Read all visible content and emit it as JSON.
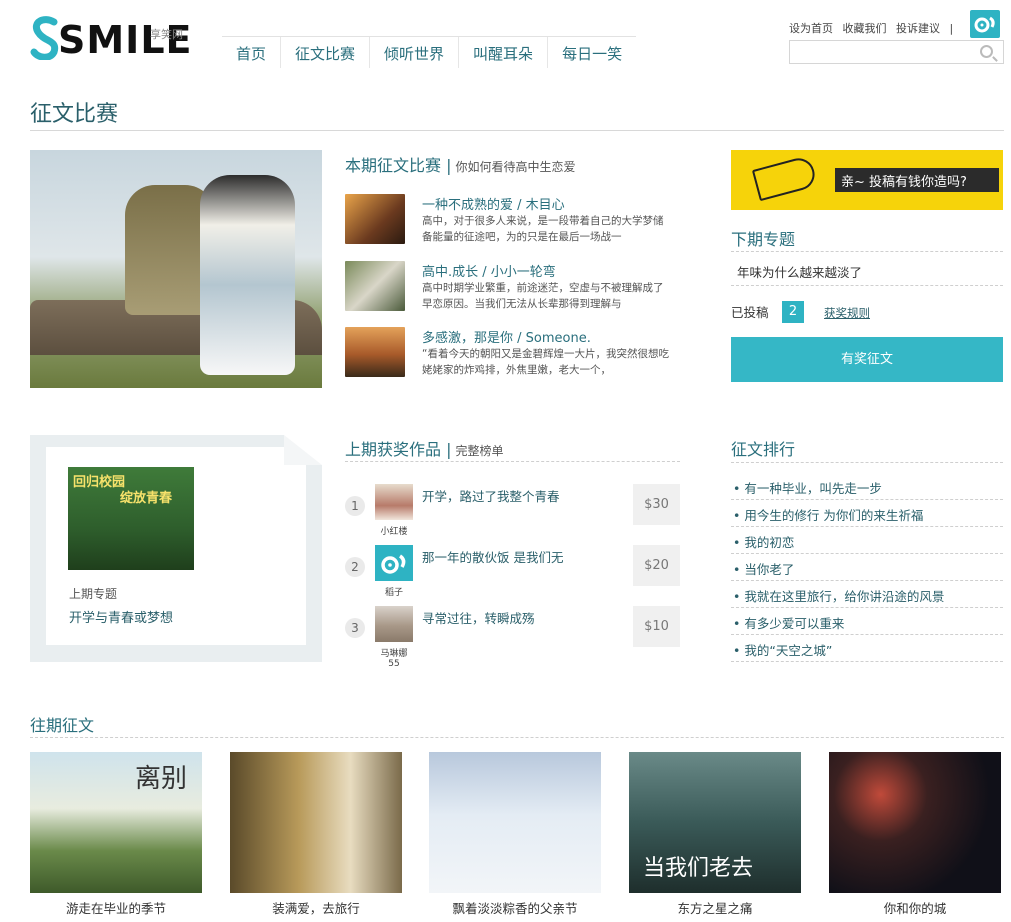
{
  "header": {
    "logo_text": "SMILE",
    "logo_sub": "享笑网",
    "nav": [
      "首页",
      "征文比赛",
      "倾听世界",
      "叫醒耳朵",
      "每日一笑"
    ],
    "toplinks": [
      "设为首页",
      "收藏我们",
      "投诉建议",
      "|"
    ],
    "search_placeholder": ""
  },
  "page_title": "征文比赛",
  "current": {
    "heading": "本期征文比赛",
    "sep": "|",
    "subheading": "你如何看待高中生恋爱",
    "items": [
      {
        "title": "一种不成熟的爱 / 木目心",
        "desc": "高中，对于很多人来说，是一段带着自己的大学梦储备能量的征途吧，为的只是在最后一场战一"
      },
      {
        "title": "高中.成长 / 小小一轮弯",
        "desc": "高中时期学业繁重，前途迷茫，空虚与不被理解成了早恋原因。当我们无法从长辈那得到理解与"
      },
      {
        "title": "多感激，那是你 / Someone.",
        "desc": "“看着今天的朝阳又是金碧辉煌一大片，我突然很想吃姥姥家的炸鸡排，外焦里嫩，老大一个，"
      }
    ]
  },
  "right": {
    "banner_text": "亲~ 投稿有钱你造吗?",
    "next_heading": "下期专题",
    "next_topic": "年味为什么越来越淡了",
    "submitted_label": "已投稿",
    "submitted_count": "2",
    "rules_link": "获奖规则",
    "submit_button": "有奖征文"
  },
  "prev_topic": {
    "poster_line1": "回归校园",
    "poster_line2": "绽放青春",
    "label": "上期专题",
    "value": "开学与青春或梦想"
  },
  "winners": {
    "heading": "上期获奖作品",
    "sep": "|",
    "subheading": "完整榜单",
    "rows": [
      {
        "rank": "1",
        "user": "小红楼",
        "title": "开学，路过了我整个青春",
        "prize": "$30"
      },
      {
        "rank": "2",
        "user": "稻子",
        "title": "那一年的散伙饭 是我们无",
        "prize": "$20"
      },
      {
        "rank": "3",
        "user": "马琳娜55",
        "title": "寻常过往，转瞬成殇",
        "prize": "$10"
      }
    ]
  },
  "ranking": {
    "heading": "征文排行",
    "items": [
      "有一种毕业，叫先走一步",
      "用今生的修行 为你们的来生祈福",
      "我的初恋",
      "当你老了",
      "我就在这里旅行，给你讲沿途的风景",
      "有多少爱可以重来",
      "我的“天空之城”"
    ]
  },
  "past": {
    "heading": "往期征文",
    "items": [
      {
        "caption": "游走在毕业的季节"
      },
      {
        "caption": "装满爱，去旅行"
      },
      {
        "caption": "飘着淡淡粽香的父亲节"
      },
      {
        "caption": "东方之星之痛"
      },
      {
        "caption": "你和你的城"
      }
    ],
    "overlay_1": "离别",
    "overlay_4": "当我们老去"
  },
  "colors": {
    "accent": "#2eb3c3",
    "text_teal": "#2a6f7d",
    "banner": "#f6d30a"
  }
}
